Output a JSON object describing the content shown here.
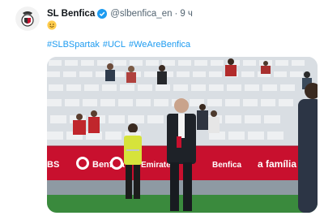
{
  "tweet": {
    "author_name": "SL Benfica",
    "handle": "@slbenfica_en",
    "separator": "·",
    "time": "9 ч",
    "hashtags": [
      "#SLBSpartak",
      "#UCL",
      "#WeAreBenfica"
    ],
    "emoji_icon": "smiling-face-icon",
    "verified_icon": "verified-badge-icon"
  },
  "photo": {
    "board_words": [
      "Benfica",
      "Emirates",
      "Benfica",
      "a família"
    ],
    "colors": {
      "board_red": "#c8102e",
      "pitch": "#3a8a3d",
      "seats": "#e8ebee"
    }
  }
}
